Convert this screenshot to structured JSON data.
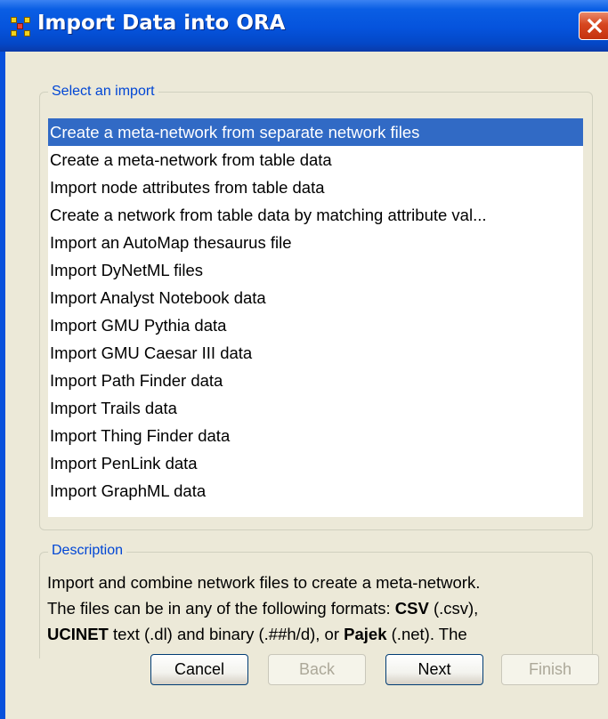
{
  "window": {
    "title": "Import Data into ORA"
  },
  "select_group": {
    "label": "Select an import",
    "items": [
      "Create a meta-network from separate network files",
      "Create a meta-network from table data",
      "Import node attributes from table data",
      "Create a network from table data by matching attribute val...",
      "Import an AutoMap thesaurus file",
      "Import DyNetML files",
      "Import Analyst Notebook data",
      "Import GMU Pythia data",
      "Import GMU Caesar III data",
      "Import Path Finder data",
      "Import Trails data",
      "Import Thing Finder data",
      "Import PenLink data",
      "Import GraphML data"
    ],
    "selected_index": 0
  },
  "description_group": {
    "label": "Description",
    "line1": "Import and combine network files to create a meta-network.",
    "line2_pre": "The files can be in any of the following formats: ",
    "line2_bold": "CSV",
    "line2_post": " (.csv),",
    "line3_bold1": "UCINET",
    "line3_mid": " text (.dl) and binary (.##h/d), or ",
    "line3_bold2": "Pajek",
    "line3_post": " (.net). The"
  },
  "buttons": {
    "cancel": "Cancel",
    "back": "Back",
    "next": "Next",
    "finish": "Finish"
  },
  "colors": {
    "titlebar": "#0553dc",
    "selection": "#316ac5",
    "group_label": "#0046d5",
    "dialog_bg": "#ece9d8"
  }
}
